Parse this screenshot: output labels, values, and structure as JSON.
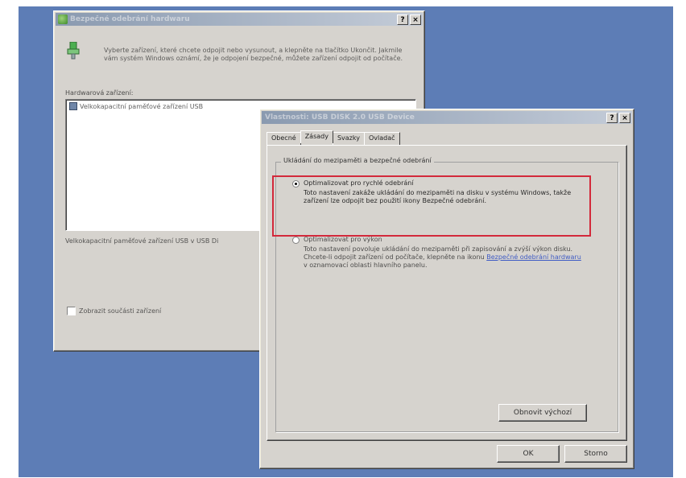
{
  "dialog_back": {
    "title": "Bezpečné odebrání hardwaru",
    "help_btn": "?",
    "close_btn": "×",
    "description": "Vyberte zařízení, které chcete odpojit nebo vysunout, a klepněte na tlačítko Ukončit. Jakmile vám systém Windows oznámí, že je odpojení bezpečné, můžete zařízení odpojit od počítače.",
    "devices_label": "Hardwarová zařízení:",
    "devices": [
      {
        "name": "Velkokapacitní paměťové zařízení USB"
      }
    ],
    "status_text": "Velkokapacitní paměťové zařízení USB v USB Di",
    "show_components_label": "Zobrazit součásti zařízení"
  },
  "dialog_front": {
    "title": "Vlastnosti: USB DISK 2.0 USB Device",
    "help_btn": "?",
    "close_btn": "×",
    "tabs": [
      {
        "label": "Obecné"
      },
      {
        "label": "Zásady"
      },
      {
        "label": "Svazky"
      },
      {
        "label": "Ovladač"
      }
    ],
    "group_title": "Ukládání do mezipaměti a bezpečné odebrání",
    "option_removal": {
      "label": "Optimalizovat pro rychlé odebrání",
      "desc": "Toto nastavení zakáže ukládání do mezipaměti na disku v systému Windows, takže zařízení lze odpojit bez použití ikony Bezpečné odebrání.",
      "selected": true
    },
    "option_performance": {
      "label": "Optimalizovat pro výkon",
      "desc_before": "Toto nastavení povoluje ukládání do mezipaměti při zapisování a zvýší výkon disku. Chcete-li odpojit zařízení od počítače, klepněte na ikonu",
      "desc_link": "Bezpečné odebrání hardwaru",
      "desc_after": "v oznamovací oblasti hlavního panelu.",
      "selected": false
    },
    "restore_btn": "Obnovit výchozí",
    "ok_btn": "OK",
    "cancel_btn": "Storno"
  },
  "colors": {
    "desktop": "#5d7db6",
    "window": "#d6d3ce",
    "highlight": "#d3293b",
    "link": "#1a3ec2"
  }
}
